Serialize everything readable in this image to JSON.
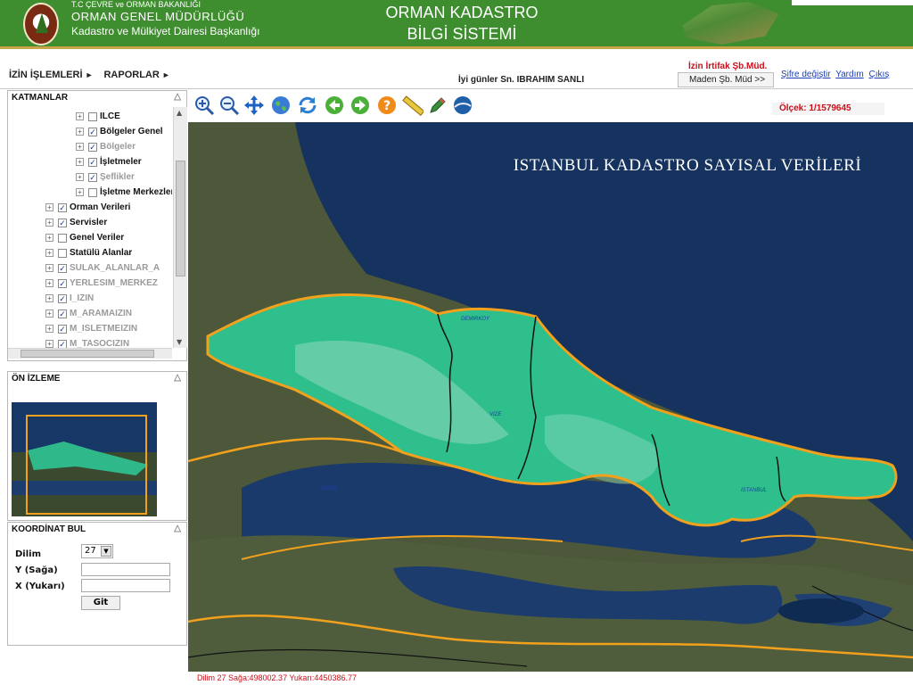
{
  "header": {
    "ministry": "T.C ÇEVRE ve ORMAN BAKANLIĞI",
    "org_name": "ORMAN GENEL MÜDÜRLÜĞÜ",
    "department": "Kadastro ve Mülkiyet Dairesi Başkanlığı",
    "title_line1": "ORMAN KADASTRO",
    "title_line2": "BİLGİ SİSTEMİ"
  },
  "menu": {
    "item1": "İZİN İŞLEMLERİ",
    "item2": "RAPORLAR",
    "arrow": "►",
    "greeting": "İyi günler Sn. IBRAHIM SANLI",
    "authority": "İzin İrtifak Şb.Müd.",
    "selected_department": "Maden Şb. Müd >>",
    "link_password": "Şifre değiştir",
    "link_help": "Yardım",
    "link_exit": "Çıkış"
  },
  "layers_panel": {
    "title": "KATMANLAR",
    "collapse": "△",
    "items": [
      {
        "label": "ILCE",
        "checked": false,
        "enabled": true
      },
      {
        "label": "Bölgeler Genel",
        "checked": true,
        "enabled": true
      },
      {
        "label": "Bölgeler",
        "checked": true,
        "enabled": false
      },
      {
        "label": "İşletmeler",
        "checked": true,
        "enabled": true
      },
      {
        "label": "Şeflikler",
        "checked": true,
        "enabled": false
      },
      {
        "label": "İşletme Merkezleri",
        "checked": false,
        "enabled": true
      },
      {
        "label": "Orman Verileri",
        "checked": true,
        "enabled": true
      },
      {
        "label": "Servisler",
        "checked": true,
        "enabled": true
      },
      {
        "label": "Genel Veriler",
        "checked": false,
        "enabled": true
      },
      {
        "label": "Statülü Alanlar",
        "checked": false,
        "enabled": true
      },
      {
        "label": "SULAK_ALANLAR_A",
        "checked": true,
        "enabled": false
      },
      {
        "label": "YERLESIM_MERKEZ",
        "checked": true,
        "enabled": false
      },
      {
        "label": "I_IZIN",
        "checked": true,
        "enabled": false
      },
      {
        "label": "M_ARAMAIZIN",
        "checked": true,
        "enabled": false
      },
      {
        "label": "M_ISLETMEIZIN",
        "checked": true,
        "enabled": false
      },
      {
        "label": "M_TASOCIZIN",
        "checked": true,
        "enabled": false
      }
    ],
    "check_mark": "✓",
    "expand_mark": "+"
  },
  "preview_panel": {
    "title": "ÖN İZLEME",
    "collapse": "△"
  },
  "coord_panel": {
    "title": "KOORDİNAT BUL",
    "collapse": "△",
    "zone_label": "Dilim",
    "zone_value": "27",
    "y_label": "Y (Sağa)",
    "x_label": "X (Yukarı)",
    "y_value": "",
    "x_value": "",
    "go_label": "Git"
  },
  "toolbar": {
    "tools": [
      "zoom-in",
      "zoom-out",
      "pan",
      "full-extent",
      "refresh",
      "back",
      "forward",
      "help",
      "measure",
      "identify",
      "google-earth"
    ],
    "scale_text": "Ölçek: 1/1579645"
  },
  "map": {
    "title": "ISTANBUL KADASTRO SAYISAL VERİLERİ",
    "labels": [
      "DEMIRKOY",
      "VIZE",
      "SARAY",
      "ISTANBUL"
    ]
  },
  "status": {
    "coordinates": "Dilim 27 Sağa:498002.37 Yukarı:4450386.77"
  },
  "colors": {
    "header_green": "#3e8e2f",
    "forest_green": "#2fb88a",
    "border_orange": "#f2a11c",
    "alert_red": "#c8101a",
    "link_blue": "#1a3fb7"
  }
}
